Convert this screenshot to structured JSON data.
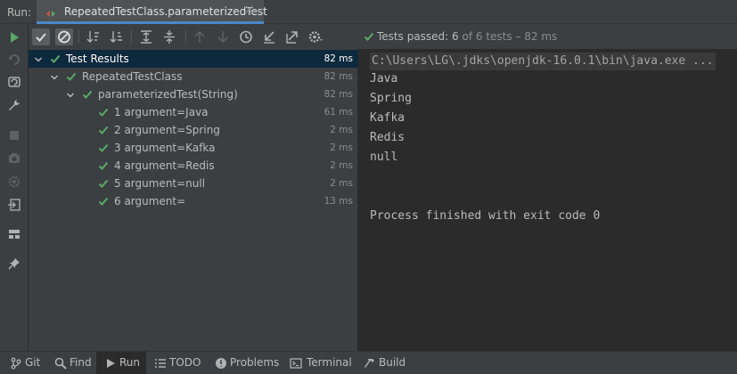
{
  "header": {
    "run_label": "Run:",
    "tab_title": "RepeatedTestClass.parameterizedTest",
    "tab_close": "×"
  },
  "colors": {
    "pass_green": "#59a869",
    "accent_blue": "#4a88c7",
    "selected_row": "#0d293e"
  },
  "status": {
    "prefix": "Tests passed: ",
    "passed": "6",
    "suffix": " of 6 tests – 82 ms"
  },
  "tree": {
    "rows": [
      {
        "label": "Test Results",
        "duration": "82 ms"
      },
      {
        "label": "RepeatedTestClass",
        "duration": "82 ms"
      },
      {
        "label": "parameterizedTest(String)",
        "duration": "82 ms"
      },
      {
        "label": "1 argument=Java",
        "duration": "61 ms"
      },
      {
        "label": "2 argument=Spring",
        "duration": "2 ms"
      },
      {
        "label": "3 argument=Kafka",
        "duration": "2 ms"
      },
      {
        "label": "4 argument=Redis",
        "duration": "2 ms"
      },
      {
        "label": "5 argument=null",
        "duration": "2 ms"
      },
      {
        "label": "6 argument=",
        "duration": "13 ms"
      }
    ]
  },
  "console": {
    "command": "C:\\Users\\LG\\.jdks\\openjdk-16.0.1\\bin\\java.exe ...",
    "lines": [
      "Java",
      "Spring",
      "Kafka",
      "Redis",
      "null"
    ],
    "exit": "Process finished with exit code 0"
  },
  "bottom_tabs": [
    {
      "label": "Git",
      "icon": "git-icon"
    },
    {
      "label": "Find",
      "icon": "search-icon"
    },
    {
      "label": "Run",
      "icon": "play-icon"
    },
    {
      "label": "TODO",
      "icon": "list-icon"
    },
    {
      "label": "Problems",
      "icon": "problems-icon"
    },
    {
      "label": "Terminal",
      "icon": "terminal-icon"
    },
    {
      "label": "Build",
      "icon": "hammer-icon"
    }
  ]
}
